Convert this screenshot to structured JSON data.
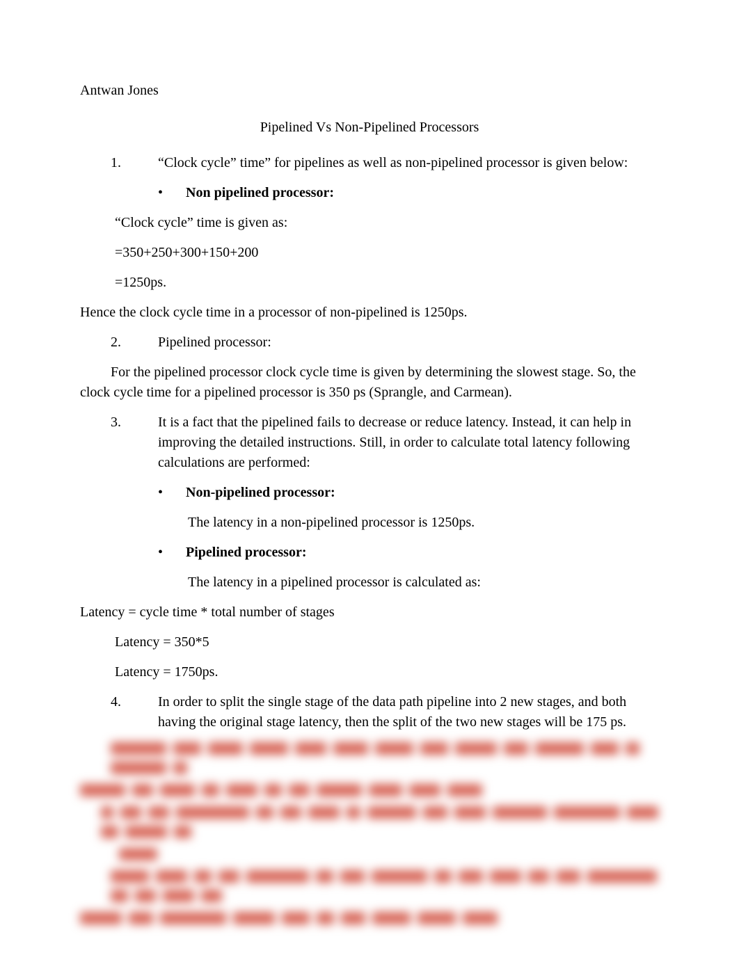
{
  "author": "Antwan Jones",
  "title": "Pipelined Vs Non-Pipelined Processors",
  "q1_intro": "“Clock cycle” time” for pipelines as well as non-pipelined processor is given below:",
  "q1_bullet": "Non pipelined processor:",
  "q1_line1": "“Clock cycle” time is given as:",
  "q1_line2": "=350+250+300+150+200",
  "q1_line3": "=1250ps.",
  "q1_conclusion": "Hence the clock cycle time in a processor of non-pipelined is 1250ps.",
  "q2_label": "Pipelined processor:",
  "q2_body": "For the pipelined processor clock cycle time is given by determining the slowest stage. So, the clock cycle time for a pipelined processor is 350 ps (Sprangle, and Carmean).",
  "q3_body": "It is a fact that the pipelined fails to decrease or reduce latency. Instead, it can help in improving the detailed instructions. Still, in order to calculate total latency following calculations are performed:",
  "q3_bullet1": "Non-pipelined processor:",
  "q3_bullet1_body": "The latency in a non-pipelined processor is 1250ps.",
  "q3_bullet2": "Pipelined processor:",
  "q3_bullet2_body": "The latency in a pipelined processor is calculated as:",
  "latency_formula": "Latency = cycle time * total number of stages",
  "latency_calc1": "Latency = 350*5",
  "latency_calc2": "Latency = 1750ps.",
  "q4_body": "In order to split the single stage of the data path pipeline into 2 new stages, and both having the original stage latency, then the split of the two new stages will be 175 ps.",
  "nums": {
    "n1": "1.",
    "n2": "2.",
    "n3": "3.",
    "n4": "4."
  },
  "bullet": "•"
}
